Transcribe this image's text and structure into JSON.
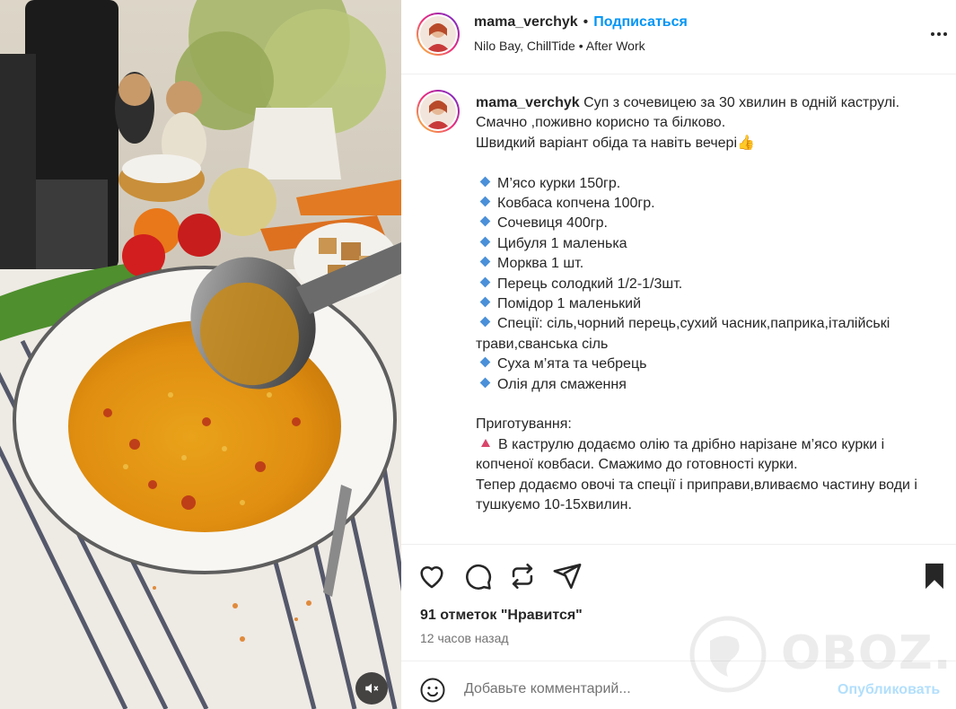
{
  "post": {
    "username": "mama_verchyk",
    "follow_label": "Подписаться",
    "separator": "•",
    "audio": "Nilo Bay, ChillTide",
    "audio_sep": "•",
    "audio_track": "After Work"
  },
  "caption": {
    "username": "mama_verchyk",
    "intro": " Суп з сочевицею за 30 хвилин в одній каструлі.",
    "lines": [
      "Смачно ,поживно корисно та білково.",
      "Швидкий варіант обіда та навіть вечері👍"
    ],
    "ingredients": [
      "М’ясо курки 150гр.",
      "Ковбаса копчена 100гр.",
      "Сочевиця 400гр.",
      "Цибуля 1 маленька",
      "Морква 1 шт.",
      "Перець солодкий 1/2-1/3шт.",
      "Помідор 1 маленький",
      "Спеції: сіль,чорний перець,сухий часник,паприка,італійські трави,сванська сіль",
      "Суха м’ята та чебрець",
      "Олія для смаження"
    ],
    "prep_title": "Приготування:",
    "step1": "В каструлю додаємо олію та дрібно нарізане м’ясо курки і копченої ковбаси. Смажимо до готовності курки.",
    "step2": "Тепер додаємо овочі та спеції і приправи,вливаємо частину води і тушкуємо 10-15хвилин."
  },
  "stats": {
    "likes": "91 отметок \"Нравится\"",
    "time": "12 часов назад"
  },
  "comment": {
    "placeholder": "Добавьте комментарий...",
    "publish": "Опубликовать"
  },
  "watermark": "OBOZ.UA",
  "icons": {
    "more": "more-icon",
    "like": "heart-icon",
    "comment": "comment-icon",
    "repost": "repost-icon",
    "share": "send-icon",
    "save": "bookmark-icon",
    "emoji": "emoji-icon",
    "mute": "muted-speaker-icon"
  }
}
